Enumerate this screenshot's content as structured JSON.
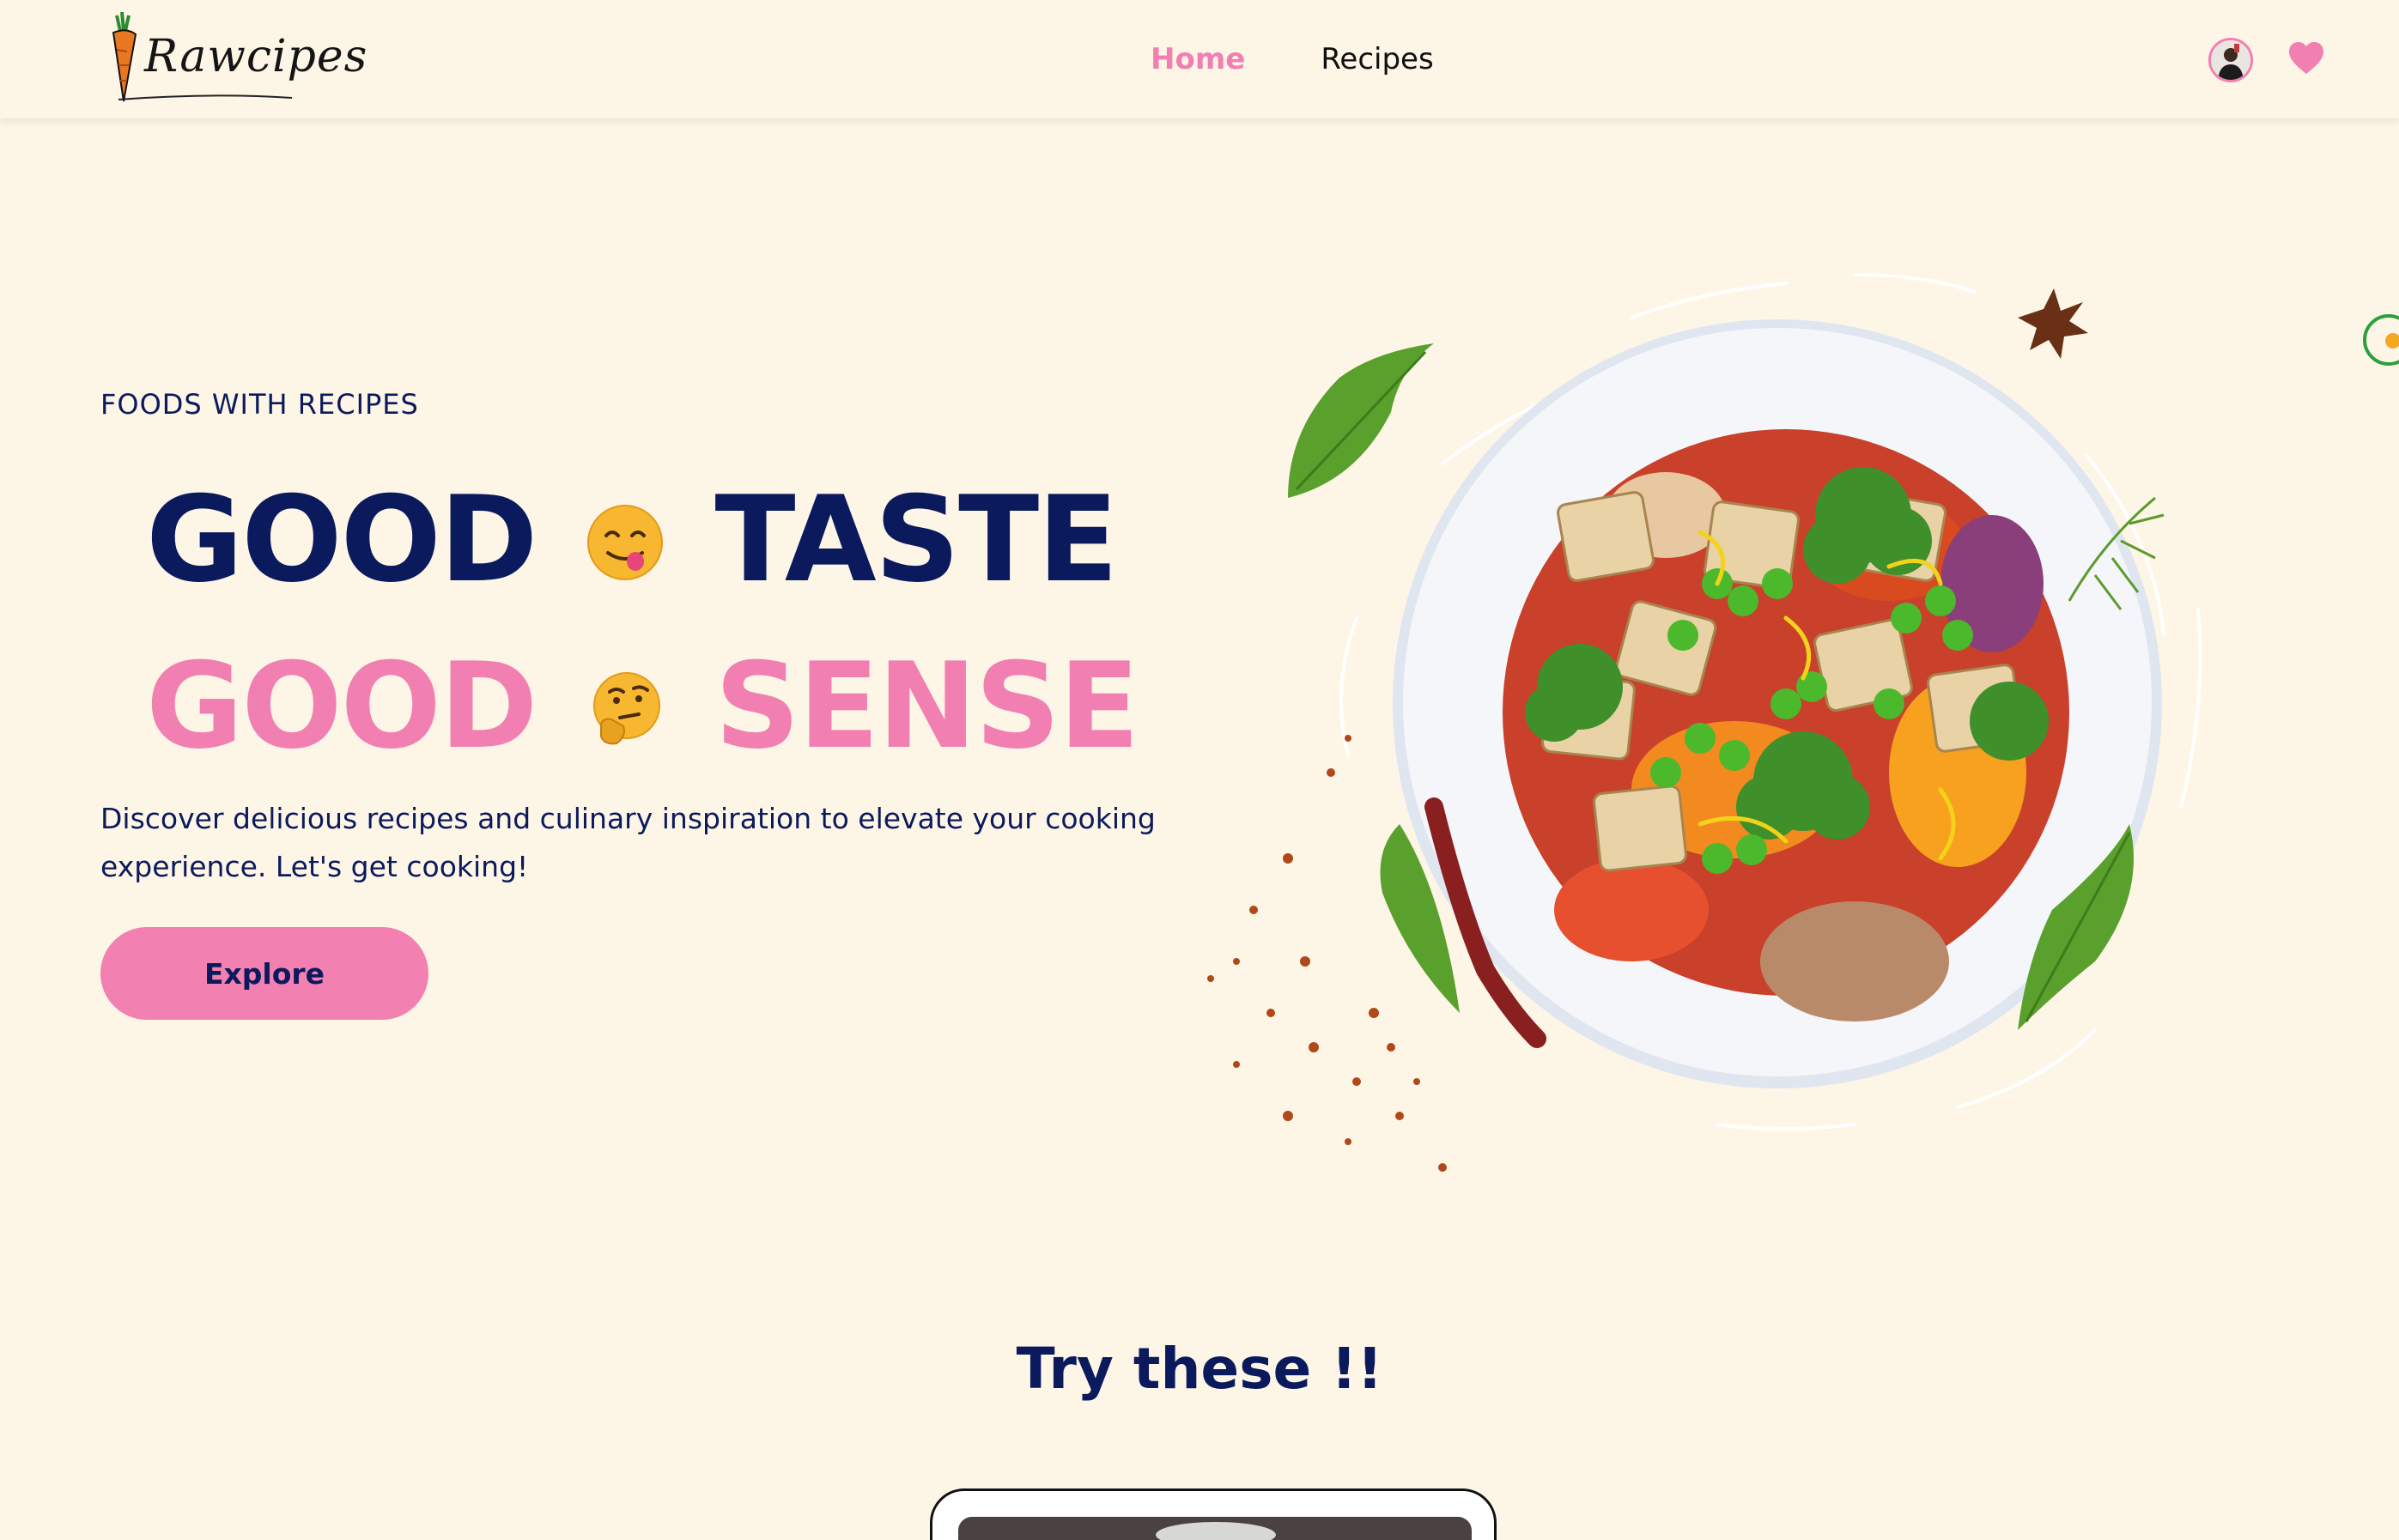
{
  "app": {
    "brand": "Rawcipes"
  },
  "nav": {
    "links": [
      {
        "label": "Home",
        "active": true
      },
      {
        "label": "Recipes",
        "active": false
      }
    ]
  },
  "header_icons": {
    "avatar": "user-avatar",
    "favorites": "heart-icon"
  },
  "hero": {
    "eyebrow": "FOODS WITH RECIPES",
    "line1": {
      "word1": "GOOD",
      "emoji": "yum-face-emoji",
      "word2": "TASTE"
    },
    "line2": {
      "word1": "GOOD",
      "emoji": "thinking-face-emoji",
      "word2": "SENSE"
    },
    "description": "Discover delicious recipes and culinary inspiration to elevate your cooking experience. Let's get cooking!",
    "cta_label": "Explore",
    "image": "vegetable-tofu-plate"
  },
  "section": {
    "title": "Try these !!"
  },
  "colors": {
    "background": "#fdf6e7",
    "navy": "#0b1a5c",
    "pink": "#f27fb1",
    "accent_green": "#2e9f3e"
  }
}
